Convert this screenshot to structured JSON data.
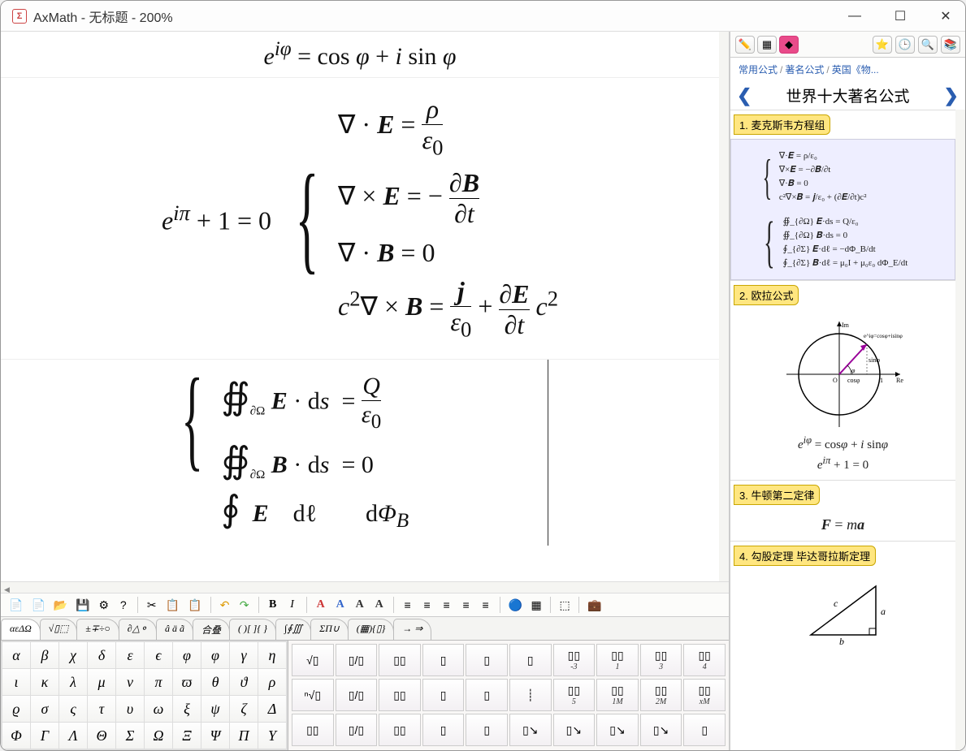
{
  "titlebar": {
    "app_icon": "Σ",
    "title": "AxMath - 无标题 - 200%"
  },
  "editor": {
    "formula1": "e^{iφ} = cos φ + i sin φ",
    "formula2_left": "e^{iπ} + 1 = 0",
    "formula2_brace": [
      "∇ · 𝑬 = ρ / ε₀",
      "∇ × 𝑬 = − ∂𝑩 / ∂t",
      "∇ · 𝑩 = 0",
      "c² ∇ × 𝑩 = 𝒋 / ε₀ + (∂𝑬 / ∂t) c²"
    ],
    "formula3_brace": [
      "∯_{∂Ω} 𝑬 · ds = Q / ε₀",
      "∯_{∂Ω} 𝑩 · ds = 0",
      "∮  𝑬 · dℓ        dΦ_B"
    ]
  },
  "toolbar": {
    "btns1": [
      "📄",
      "📄",
      "📂",
      "💾",
      "⚙",
      "?"
    ],
    "btns2": [
      "✂",
      "📋",
      "📋"
    ],
    "btns3": [
      "↶",
      "↷"
    ],
    "btns4": [
      "B",
      "I"
    ],
    "btns5": [
      "A",
      "A",
      "A",
      "A"
    ],
    "btns6": [
      "≡",
      "≡",
      "≡",
      "≡",
      "≡"
    ],
    "btns7": [
      "🔵",
      "▦"
    ],
    "btns8": [
      "⬚"
    ],
    "btns9": [
      "💼"
    ]
  },
  "tabs": [
    "αεΔΩ",
    "√▯⬚",
    "±∓÷○",
    "∂△⚬",
    "â ä ã",
    "合叠",
    "( )[ ]{ }",
    "∫∮∭",
    "ΣΠ∪",
    "(▦){▯}",
    "→ ⇒"
  ],
  "greek": [
    "α",
    "β",
    "χ",
    "δ",
    "ε",
    "ϵ",
    "φ",
    "φ",
    "γ",
    "η",
    "ι",
    "κ",
    "λ",
    "μ",
    "ν",
    "π",
    "ϖ",
    "θ",
    "ϑ",
    "ρ",
    "ϱ",
    "σ",
    "ς",
    "τ",
    "υ",
    "ω",
    "ξ",
    "ψ",
    "ζ",
    "Δ",
    "Φ",
    "Γ",
    "Λ",
    "Θ",
    "Σ",
    "Ω",
    "Ξ",
    "Ψ",
    "Π",
    "Υ"
  ],
  "structs": [
    {
      "g": "√▯",
      "l": ""
    },
    {
      "g": "▯/▯",
      "l": ""
    },
    {
      "g": "▯▯",
      "l": ""
    },
    {
      "g": "▯",
      "l": ""
    },
    {
      "g": "▯",
      "l": ""
    },
    {
      "g": "▯",
      "l": ""
    },
    {
      "g": "▯▯",
      "l": "-3"
    },
    {
      "g": "▯▯",
      "l": "1"
    },
    {
      "g": "▯▯",
      "l": "3"
    },
    {
      "g": "▯▯",
      "l": "4"
    },
    {
      "g": "ⁿ√▯",
      "l": ""
    },
    {
      "g": "▯/▯",
      "l": ""
    },
    {
      "g": "▯▯",
      "l": ""
    },
    {
      "g": "▯",
      "l": ""
    },
    {
      "g": "▯",
      "l": ""
    },
    {
      "g": "┊",
      "l": ""
    },
    {
      "g": "▯▯",
      "l": "5"
    },
    {
      "g": "▯▯",
      "l": "1M"
    },
    {
      "g": "▯▯",
      "l": "2M"
    },
    {
      "g": "▯▯",
      "l": "xM"
    },
    {
      "g": "▯▯",
      "l": ""
    },
    {
      "g": "▯/▯",
      "l": ""
    },
    {
      "g": "▯▯",
      "l": ""
    },
    {
      "g": "▯",
      "l": ""
    },
    {
      "g": "▯",
      "l": ""
    },
    {
      "g": "▯↘",
      "l": ""
    },
    {
      "g": "▯↘",
      "l": ""
    },
    {
      "g": "▯↘",
      "l": ""
    },
    {
      "g": "▯↘",
      "l": ""
    },
    {
      "g": "▯",
      "l": ""
    }
  ],
  "side": {
    "toolbar_icons": [
      "✏️",
      "▦",
      "◆",
      "⭐",
      "🕒",
      "🔍",
      "📚"
    ],
    "breadcrumb": [
      "常用公式",
      "著名公式",
      "英国《物..."
    ],
    "header": "世界十大著名公式",
    "sections": [
      {
        "title": "1. 麦克斯韦方程组",
        "type": "maxwell"
      },
      {
        "title": "2. 欧拉公式",
        "type": "euler"
      },
      {
        "title": "3. 牛顿第二定律",
        "type": "newton"
      },
      {
        "title": "4. 勾股定理 毕达哥拉斯定理",
        "type": "pythag"
      }
    ],
    "maxwell_lines": [
      "∇·𝑬 = ρ/ε₀",
      "∇×𝑬 = −∂𝑩/∂t",
      "∇·𝑩 = 0",
      "c²∇×𝑩 = 𝒋/ε₀ + (∂𝑬/∂t)c²",
      "∯_{∂Ω} 𝑬·ds = Q/ε₀",
      "∯_{∂Ω} 𝑩·ds = 0",
      "∮_{∂Σ} 𝑬·dℓ = −dΦ_B/dt",
      "∮_{∂Σ} 𝑩·dℓ = μ₀I + μ₀ε₀ dΦ_E/dt"
    ],
    "euler_formulas": [
      "e^{iφ} = cosφ + i sinφ",
      "e^{iπ} + 1 = 0"
    ],
    "euler_labels": {
      "im": "Im",
      "re": "Re",
      "o": "O",
      "one": "1",
      "eq": "e^{iφ}=cosφ+isinφ",
      "sin": "sinφ",
      "cos": "cosφ",
      "phi": "φ"
    },
    "newton_formula": "𝑭 = m𝒂",
    "pythag_labels": {
      "a": "a",
      "b": "b",
      "c": "c"
    }
  }
}
